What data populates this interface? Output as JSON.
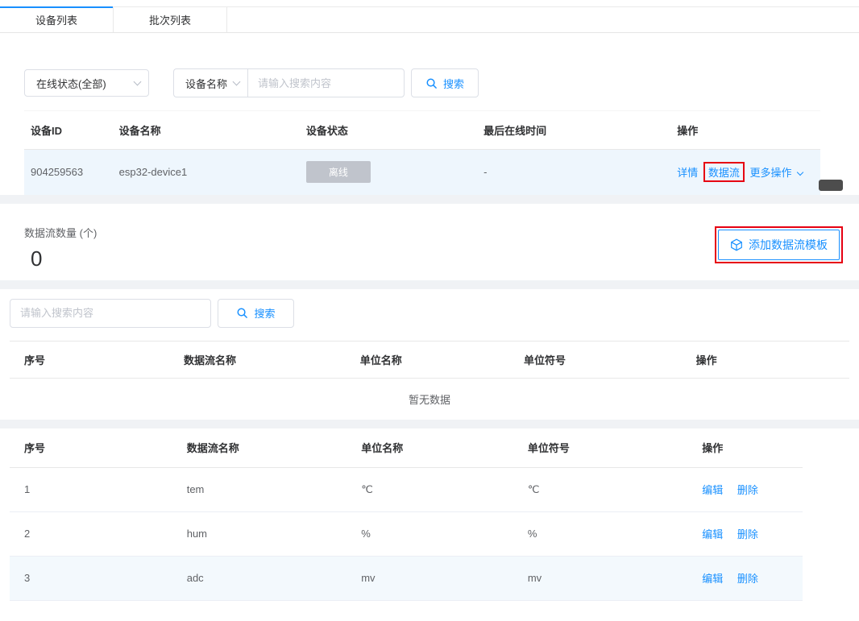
{
  "colors": {
    "accent": "#1890ff",
    "highlight_red": "#e60012",
    "offline_badge_bg": "#c0c4cc"
  },
  "tabs": {
    "device_list": "设备列表",
    "batch_list": "批次列表"
  },
  "device_panel": {
    "filters": {
      "status_select_value": "在线状态(全部)",
      "field_select_value": "设备名称",
      "search_placeholder": "请输入搜索内容",
      "search_button_label": "搜索"
    },
    "table": {
      "headers": [
        "设备ID",
        "设备名称",
        "设备状态",
        "最后在线时间",
        "操作"
      ],
      "row": {
        "id": "904259563",
        "name": "esp32-device1",
        "status": "离线",
        "last_online_time": "-",
        "action_detail": "详情",
        "action_datastream": "数据流",
        "action_more": "更多操作"
      }
    }
  },
  "datastream_panel": {
    "count_label": "数据流数量 (个)",
    "count_value": "0",
    "add_template_button": "添加数据流模板",
    "search_placeholder": "请输入搜索内容",
    "search_button_label": "搜索",
    "table": {
      "headers": [
        "序号",
        "数据流名称",
        "单位名称",
        "单位符号",
        "操作"
      ],
      "empty_text": "暂无数据"
    }
  },
  "datastream_table": {
    "headers": [
      "序号",
      "数据流名称",
      "单位名称",
      "单位符号",
      "操作"
    ],
    "action_edit": "编辑",
    "action_delete": "删除",
    "rows": [
      {
        "index": "1",
        "name": "tem",
        "unit_name": "℃",
        "unit_symbol": "℃"
      },
      {
        "index": "2",
        "name": "hum",
        "unit_name": "%",
        "unit_symbol": "%"
      },
      {
        "index": "3",
        "name": "adc",
        "unit_name": "mv",
        "unit_symbol": "mv"
      }
    ]
  }
}
